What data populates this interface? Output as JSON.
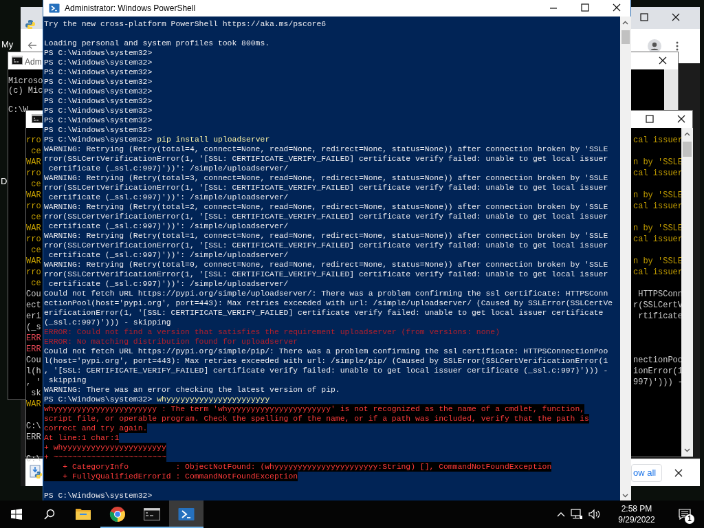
{
  "desktop": {
    "labels": [
      "My",
      "D"
    ]
  },
  "browser_window": {
    "download_shelf": {
      "show_all": "ow all"
    }
  },
  "console_window_1": {
    "title": "Adm",
    "lines": [
      {
        "kind": "output",
        "text": "Microso"
      },
      {
        "kind": "output",
        "text": "(c) Mic"
      },
      {
        "kind": "blank"
      },
      {
        "kind": "output",
        "text": "C:\\W"
      }
    ]
  },
  "console_window_2": {
    "lines": [
      {
        "kind": "warning",
        "left": "rro",
        "right": "cal issuer"
      },
      {
        "kind": "warning",
        "left": " ce"
      },
      {
        "kind": "warning",
        "left": "WAR",
        "right": "n by 'SSLE"
      },
      {
        "kind": "warning",
        "left": "rro",
        "right": "cal issuer"
      },
      {
        "kind": "warning",
        "left": " ce"
      },
      {
        "kind": "warning",
        "left": "WAR",
        "right": "n by 'SSLE"
      },
      {
        "kind": "warning",
        "left": "rro",
        "right": "cal issuer"
      },
      {
        "kind": "warning",
        "left": " ce"
      },
      {
        "kind": "warning",
        "left": "WAR",
        "right": "n by 'SSLE"
      },
      {
        "kind": "warning",
        "left": "rro",
        "right": "cal issuer"
      },
      {
        "kind": "warning",
        "left": " ce"
      },
      {
        "kind": "warning",
        "left": "WAR",
        "right": "n by 'SSLE"
      },
      {
        "kind": "warning",
        "left": "rro",
        "right": "cal issuer"
      },
      {
        "kind": "warning",
        "left": " ce"
      },
      {
        "kind": "output",
        "left": "Cou",
        "right": " HTTPSConn"
      },
      {
        "kind": "output",
        "left": "ect",
        "right": "r(SSLCertV"
      },
      {
        "kind": "output",
        "left": "eri",
        "right": " rtificate"
      },
      {
        "kind": "output",
        "left": "(_s"
      },
      {
        "kind": "error",
        "left": "ERR"
      },
      {
        "kind": "error",
        "left": "ERR"
      },
      {
        "kind": "output",
        "left": "Cou",
        "right": "nectionPoo"
      },
      {
        "kind": "output",
        "left": "l(h",
        "right": "ionError(1"
      },
      {
        "kind": "output",
        "left": ", '",
        "right": "997)'))) -"
      },
      {
        "kind": "output",
        "left": " sk"
      },
      {
        "kind": "warning",
        "left": "WAR"
      },
      {
        "kind": "blank"
      },
      {
        "kind": "output",
        "left": "C:\\"
      },
      {
        "kind": "output",
        "left": "ERR"
      },
      {
        "kind": "blank"
      },
      {
        "kind": "output",
        "left": "C:\\"
      }
    ]
  },
  "powershell_window": {
    "title": "Administrator: Windows PowerShell",
    "lines": [
      {
        "kind": "output",
        "text": "Try the new cross-platform PowerShell https://aka.ms/pscore6"
      },
      {
        "kind": "blank"
      },
      {
        "kind": "output",
        "text": "Loading personal and system profiles took 800ms."
      },
      {
        "kind": "prompt",
        "text": "PS C:\\Windows\\system32>"
      },
      {
        "kind": "prompt",
        "text": "PS C:\\Windows\\system32>"
      },
      {
        "kind": "prompt",
        "text": "PS C:\\Windows\\system32>"
      },
      {
        "kind": "prompt",
        "text": "PS C:\\Windows\\system32>"
      },
      {
        "kind": "prompt",
        "text": "PS C:\\Windows\\system32>"
      },
      {
        "kind": "prompt",
        "text": "PS C:\\Windows\\system32>"
      },
      {
        "kind": "prompt",
        "text": "PS C:\\Windows\\system32>"
      },
      {
        "kind": "prompt",
        "text": "PS C:\\Windows\\system32>"
      },
      {
        "kind": "prompt",
        "text": "PS C:\\Windows\\system32>"
      },
      {
        "kind": "prompt",
        "text": "PS C:\\Windows\\system32>",
        "command": "pip install uploadserver"
      },
      {
        "kind": "output",
        "text": "WARNING: Retrying (Retry(total=4, connect=None, read=None, redirect=None, status=None)) after connection broken by 'SSLE"
      },
      {
        "kind": "output",
        "text": "rror(SSLCertVerificationError(1, '[SSL: CERTIFICATE_VERIFY_FAILED] certificate verify failed: unable to get local issuer"
      },
      {
        "kind": "output",
        "text": " certificate (_ssl.c:997)'))': /simple/uploadserver/"
      },
      {
        "kind": "output",
        "text": "WARNING: Retrying (Retry(total=3, connect=None, read=None, redirect=None, status=None)) after connection broken by 'SSLE"
      },
      {
        "kind": "output",
        "text": "rror(SSLCertVerificationError(1, '[SSL: CERTIFICATE_VERIFY_FAILED] certificate verify failed: unable to get local issuer"
      },
      {
        "kind": "output",
        "text": " certificate (_ssl.c:997)'))': /simple/uploadserver/"
      },
      {
        "kind": "output",
        "text": "WARNING: Retrying (Retry(total=2, connect=None, read=None, redirect=None, status=None)) after connection broken by 'SSLE"
      },
      {
        "kind": "output",
        "text": "rror(SSLCertVerificationError(1, '[SSL: CERTIFICATE_VERIFY_FAILED] certificate verify failed: unable to get local issuer"
      },
      {
        "kind": "output",
        "text": " certificate (_ssl.c:997)'))': /simple/uploadserver/"
      },
      {
        "kind": "output",
        "text": "WARNING: Retrying (Retry(total=1, connect=None, read=None, redirect=None, status=None)) after connection broken by 'SSLE"
      },
      {
        "kind": "output",
        "text": "rror(SSLCertVerificationError(1, '[SSL: CERTIFICATE_VERIFY_FAILED] certificate verify failed: unable to get local issuer"
      },
      {
        "kind": "output",
        "text": " certificate (_ssl.c:997)'))': /simple/uploadserver/"
      },
      {
        "kind": "output",
        "text": "WARNING: Retrying (Retry(total=0, connect=None, read=None, redirect=None, status=None)) after connection broken by 'SSLE"
      },
      {
        "kind": "output",
        "text": "rror(SSLCertVerificationError(1, '[SSL: CERTIFICATE_VERIFY_FAILED] certificate verify failed: unable to get local issuer"
      },
      {
        "kind": "output",
        "text": " certificate (_ssl.c:997)'))': /simple/uploadserver/"
      },
      {
        "kind": "output",
        "text": "Could not fetch URL https://pypi.org/simple/uploadserver/: There was a problem confirming the ssl certificate: HTTPSConn"
      },
      {
        "kind": "output",
        "text": "ectionPool(host='pypi.org', port=443): Max retries exceeded with url: /simple/uploadserver/ (Caused by SSLError(SSLCertVe"
      },
      {
        "kind": "output",
        "text": "erificationError(1, '[SSL: CERTIFICATE_VERIFY_FAILED] certificate verify failed: unable to get local issuer certificate"
      },
      {
        "kind": "output",
        "text": "(_ssl.c:997)'))) - skipping"
      },
      {
        "kind": "pip-error",
        "text": "ERROR: Could not find a version that satisfies the requirement uploadserver (from versions: none)"
      },
      {
        "kind": "pip-error",
        "text": "ERROR: No matching distribution found for uploadserver"
      },
      {
        "kind": "output",
        "text": "Could not fetch URL https://pypi.org/simple/pip/: There was a problem confirming the ssl certificate: HTTPSConnectionPoo"
      },
      {
        "kind": "output",
        "text": "l(host='pypi.org', port=443): Max retries exceeded with url: /simple/pip/ (Caused by SSLError(SSLCertVerificationError(1"
      },
      {
        "kind": "output",
        "text": ", '[SSL: CERTIFICATE_VERIFY_FAILED] certificate verify failed: unable to get local issuer certificate (_ssl.c:997)'))) -"
      },
      {
        "kind": "output",
        "text": " skipping"
      },
      {
        "kind": "output",
        "text": "WARNING: There was an error checking the latest version of pip."
      },
      {
        "kind": "prompt",
        "text": "PS C:\\Windows\\system32>",
        "command": "whyyyyyyyyyyyyyyyyyyyyyy"
      },
      {
        "kind": "ps-error",
        "text": "whyyyyyyyyyyyyyyyyyyyyyy : The term 'whyyyyyyyyyyyyyyyyyyyyyy' is not recognized as the name of a cmdlet, function,"
      },
      {
        "kind": "ps-error",
        "text": "script file, or operable program. Check the spelling of the name, or if a path was included, verify that the path is"
      },
      {
        "kind": "ps-error",
        "text": "correct and try again."
      },
      {
        "kind": "ps-error",
        "text": "At line:1 char:1"
      },
      {
        "kind": "ps-error",
        "text": "+ whyyyyyyyyyyyyyyyyyyyyyy"
      },
      {
        "kind": "ps-error",
        "text": "+ ~~~~~~~~~~~~~~~~~~~~~~~~"
      },
      {
        "kind": "ps-error",
        "text": "    + CategoryInfo          : ObjectNotFound: (whyyyyyyyyyyyyyyyyyyyyyy:String) [], CommandNotFoundException"
      },
      {
        "kind": "ps-error",
        "text": "    + FullyQualifiedErrorId : CommandNotFoundException"
      },
      {
        "kind": "blank"
      },
      {
        "kind": "prompt",
        "text": "PS C:\\Windows\\system32>"
      }
    ]
  },
  "taskbar": {
    "apps": [
      {
        "kind": "file-explorer",
        "running": false,
        "active": false
      },
      {
        "kind": "chrome",
        "running": true,
        "active": false
      },
      {
        "kind": "command-prompt",
        "running": true,
        "active": false
      },
      {
        "kind": "powershell",
        "running": true,
        "active": true
      }
    ],
    "clock": {
      "time": "2:58 PM",
      "date": "9/29/2022"
    },
    "notification_count": "1"
  }
}
